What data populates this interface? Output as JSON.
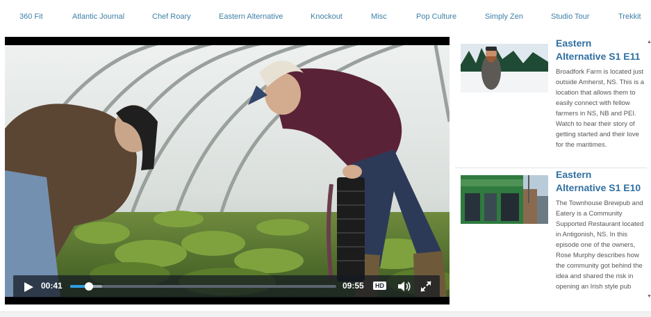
{
  "nav": {
    "items": [
      "360 Fit",
      "Atlantic Journal",
      "Chef Roary",
      "Eastern Alternative",
      "Knockout",
      "Misc",
      "Pop Culture",
      "Simply Zen",
      "Studio Tour",
      "Trekkit"
    ]
  },
  "player": {
    "current_time": "00:41",
    "duration": "09:55",
    "progress_fraction": 0.07,
    "buffered_fraction": 0.12,
    "hd_label": "HD",
    "icons": [
      "play-icon",
      "volume-icon",
      "fullscreen-icon"
    ]
  },
  "sidebar": {
    "episodes": [
      {
        "title": "Eastern Alternative S1 E11",
        "description": "Broadfork Farm is located just outside Amherst, NS. This is a location that allows them to easily connect with fellow farmers in NS, NB and PEI. Watch to hear their story of getting started and their love for the maritimes."
      },
      {
        "title": "Eastern Alternative S1 E10",
        "description": "The Townhouse Brewpub and Eatery is a Community Supported Restaurant located in Antigonish, NS. In this episode one of the owners, Rose Murphy describes how the community got behind the idea and shared the risk in opening an Irish style pub"
      }
    ],
    "scroll_icons": [
      "scroll-up-icon",
      "scroll-down-icon"
    ]
  },
  "colors": {
    "nav_link": "#3d7fa6",
    "episode_title": "#2f6fa1",
    "progress": "#2f9fe0"
  }
}
